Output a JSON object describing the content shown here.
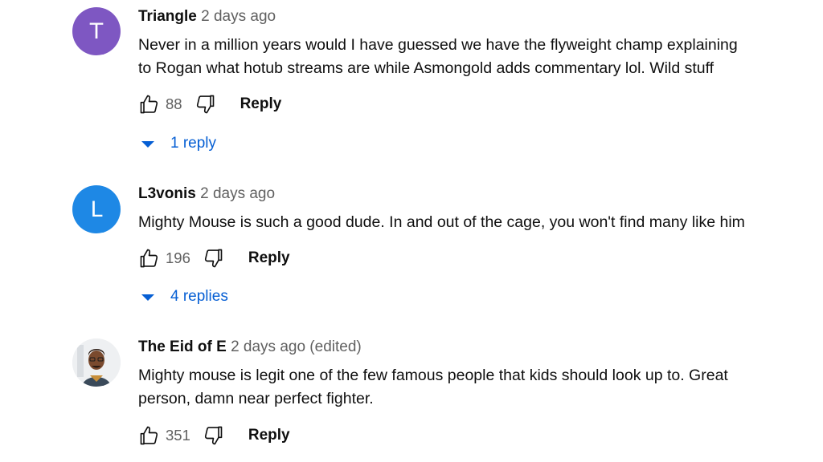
{
  "comments": [
    {
      "avatar_letter": "T",
      "avatar_color": "#7e57c2",
      "author": "Triangle",
      "time": "2 days ago",
      "lines": [
        "Never in a million years would I have guessed we have the flyweight champ explaining",
        "to Rogan what hotub streams are while  Asmongold adds commentary lol. Wild stuff"
      ],
      "likes": "88",
      "reply_label": "Reply",
      "replies_label": "1 reply"
    },
    {
      "avatar_letter": "L",
      "avatar_color": "#1e88e5",
      "author": "L3vonis",
      "time": "2 days ago",
      "lines": [
        "Mighty Mouse is such a good dude. In and out of the cage, you won't find many like him"
      ],
      "likes": "196",
      "reply_label": "Reply",
      "replies_label": "4 replies"
    },
    {
      "avatar_letter": "",
      "avatar_color": "#f1f1f1",
      "author": "The Eid of E",
      "time": "2 days ago (edited)",
      "lines": [
        "Mighty mouse is legit one of the few famous people that kids should look up to. Great",
        "person, damn near perfect fighter."
      ],
      "likes": "351",
      "reply_label": "Reply"
    }
  ],
  "icons": {
    "like": "thumb-up-icon",
    "dislike": "thumb-down-icon",
    "expand": "triangle-down-icon"
  },
  "colors": {
    "link_blue": "#065fd4",
    "secondary_text": "#606060",
    "primary_text": "#0f0f0f"
  }
}
